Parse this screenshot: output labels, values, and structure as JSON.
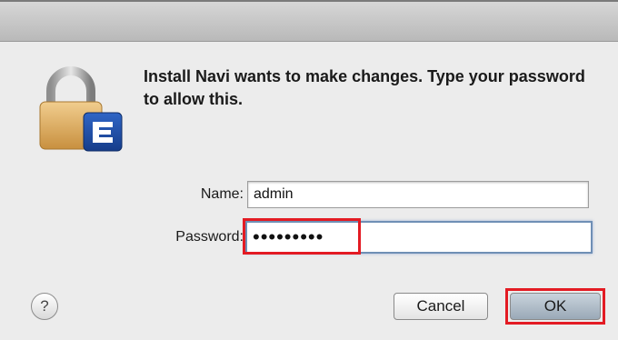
{
  "dialog": {
    "message": "Install Navi wants to make changes. Type your password to allow this."
  },
  "icons": {
    "lock": "lock-icon",
    "app_badge": "navi-app-icon",
    "help": "help-icon"
  },
  "form": {
    "name_label": "Name:",
    "name_value": "admin",
    "password_label": "Password:",
    "password_value": "•••••••••"
  },
  "buttons": {
    "help_label": "?",
    "cancel_label": "Cancel",
    "ok_label": "OK"
  },
  "colors": {
    "highlight": "#e31b23",
    "focus_ring": "#6f8fb5",
    "app_badge": "#1f4fa8"
  }
}
